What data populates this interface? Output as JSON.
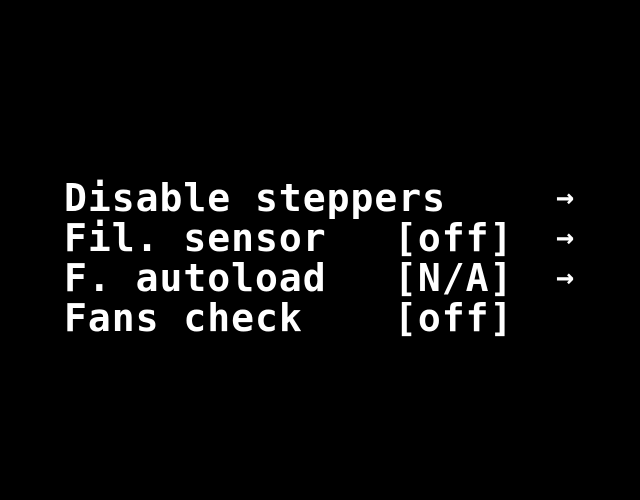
{
  "menu": {
    "items": [
      {
        "label": "Disable steppers",
        "value": "",
        "arrow": "→"
      },
      {
        "label": "Fil. sensor",
        "value": "[off]",
        "arrow": "→"
      },
      {
        "label": "F. autoload",
        "value": "[N/A]",
        "arrow": "→"
      },
      {
        "label": "Fans check",
        "value": "[off]",
        "arrow": ""
      }
    ]
  }
}
